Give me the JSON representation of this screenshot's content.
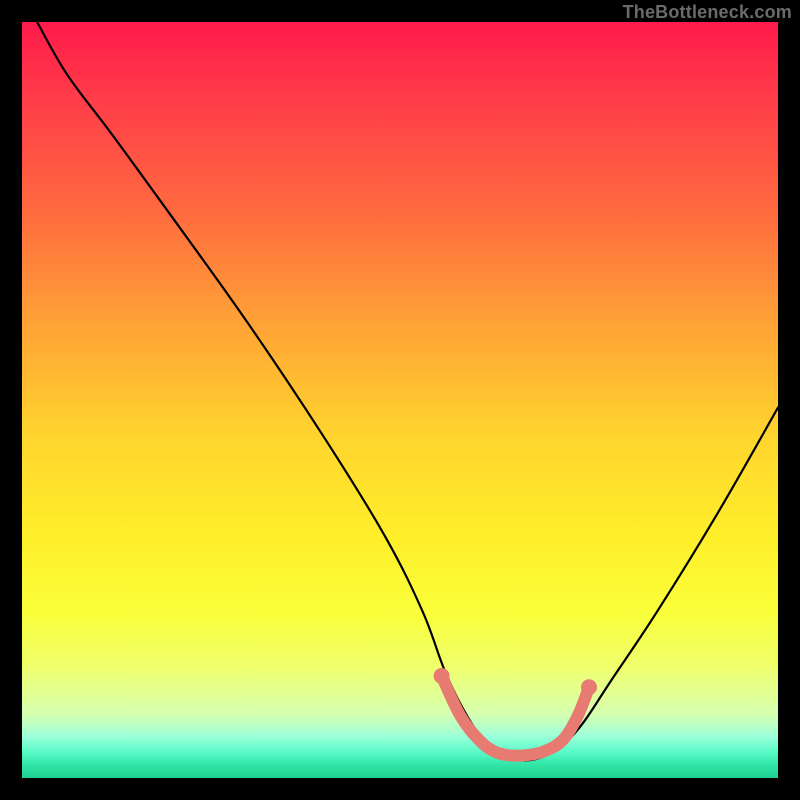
{
  "watermark": "TheBottleneck.com",
  "chart_data": {
    "type": "line",
    "title": "",
    "xlabel": "",
    "ylabel": "",
    "xlim": [
      0,
      100
    ],
    "ylim": [
      0,
      100
    ],
    "grid": false,
    "series": [
      {
        "name": "bottleneck-curve",
        "x": [
          2,
          6,
          12,
          20,
          30,
          40,
          48,
          53,
          56,
          59,
          62,
          65,
          68,
          71,
          74,
          78,
          84,
          92,
          100
        ],
        "y": [
          100,
          93,
          85,
          74,
          60,
          45,
          32,
          22,
          14,
          8,
          4,
          2.5,
          2.5,
          4,
          7,
          13,
          22,
          35,
          49
        ],
        "color": "#000000"
      }
    ],
    "highlight": {
      "name": "optimal-range",
      "color": "#e77b72",
      "points_x": [
        55.5,
        58,
        60.5,
        62.5,
        64.5,
        66.5,
        69,
        71.5,
        73.5,
        75
      ],
      "points_y": [
        13.5,
        8.2,
        5.0,
        3.5,
        3.0,
        3.0,
        3.5,
        5.0,
        8.2,
        12.0
      ]
    }
  }
}
